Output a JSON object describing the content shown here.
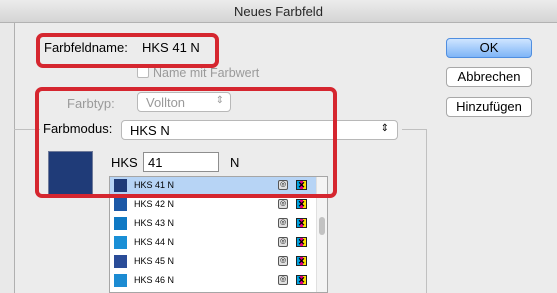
{
  "window": {
    "title": "Neues Farbfeld"
  },
  "name_field": {
    "label": "Farbfeldname:",
    "value": "HKS 41 N"
  },
  "checkbox": {
    "label": "Name mit Farbwert",
    "checked": false
  },
  "farbtyp": {
    "label": "Farbtyp:",
    "value": "Vollton"
  },
  "farbmodus": {
    "label": "Farbmodus:",
    "value": "HKS N"
  },
  "hks": {
    "label": "HKS",
    "value": "41",
    "suffix": "N",
    "preview_color": "#1f3b78"
  },
  "swatches": [
    {
      "name": "HKS 41 N",
      "color": "#1f3b78",
      "selected": true
    },
    {
      "name": "HKS 42 N",
      "color": "#1d58a6",
      "selected": false
    },
    {
      "name": "HKS 43 N",
      "color": "#0f79c4",
      "selected": false
    },
    {
      "name": "HKS 44 N",
      "color": "#1a8fd6",
      "selected": false
    },
    {
      "name": "HKS 45 N",
      "color": "#2a4c98",
      "selected": false
    },
    {
      "name": "HKS 46 N",
      "color": "#1c8bd2",
      "selected": false
    }
  ],
  "buttons": {
    "ok": "OK",
    "cancel": "Abbrechen",
    "add": "Hinzufügen"
  },
  "icons": {
    "spot": "spot-color-icon",
    "process": "cmyk-process-icon",
    "stepper": "⇕"
  },
  "accent_color": "#d5262f"
}
